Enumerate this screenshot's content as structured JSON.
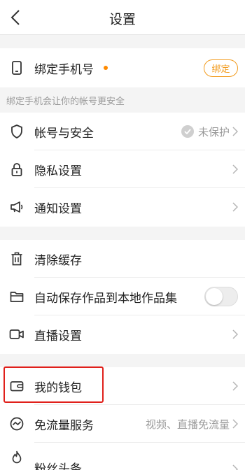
{
  "header": {
    "title": "设置",
    "back_icon": "chevron-left-icon"
  },
  "bind_phone": {
    "label": "绑定手机号",
    "button_label": "绑定",
    "icon": "phone-icon",
    "dot_color": "#ff8a00",
    "accent_color": "#f29b1d"
  },
  "hint_text": "绑定手机会让你的帐号更安全",
  "security_section": {
    "items": [
      {
        "label": "帐号与安全",
        "value": "未保护",
        "icon": "shield-icon"
      },
      {
        "label": "隐私设置",
        "icon": "lock-icon"
      },
      {
        "label": "通知设置",
        "icon": "megaphone-icon"
      }
    ]
  },
  "storage_section": {
    "items": [
      {
        "label": "清除缓存",
        "icon": "trash-icon"
      },
      {
        "label": "自动保存作品到本地作品集",
        "icon": "folder-icon",
        "toggle_on": false
      },
      {
        "label": "直播设置",
        "icon": "video-camera-icon"
      }
    ]
  },
  "services_section": {
    "items": [
      {
        "label": "我的钱包",
        "icon": "wallet-icon"
      },
      {
        "label": "免流量服务",
        "value": "视频、直播免流量",
        "icon": "data-saver-icon"
      },
      {
        "label": "粉丝头条",
        "icon": "flame-icon"
      }
    ]
  },
  "highlight_color": "#e0201b"
}
